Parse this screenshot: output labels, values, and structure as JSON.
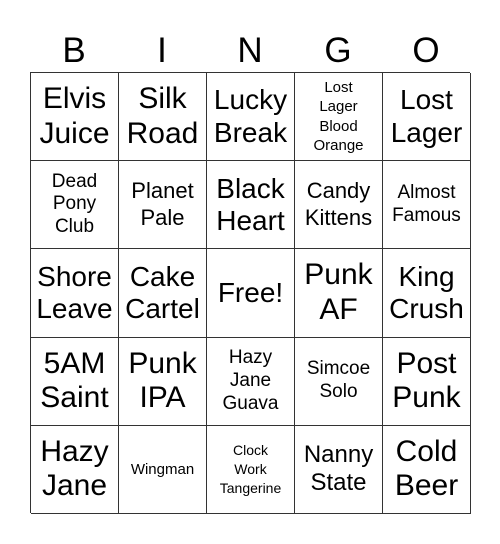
{
  "header": {
    "letters": [
      "B",
      "I",
      "N",
      "G",
      "O"
    ]
  },
  "grid": {
    "rows": [
      [
        "Elvis Juice",
        "Silk Road",
        "Lucky Break",
        "Lost Lager Blood Orange",
        "Lost Lager"
      ],
      [
        "Dead Pony Club",
        "Planet Pale",
        "Black Heart",
        "Candy Kittens",
        "Almost Famous"
      ],
      [
        "Shore Leave",
        "Cake Cartel",
        "Free!",
        "Punk AF",
        "King Crush"
      ],
      [
        "5AM Saint",
        "Punk IPA",
        "Hazy Jane Guava",
        "Simcoe Solo",
        "Post Punk"
      ],
      [
        "Hazy Jane",
        "Wingman",
        "Clock Work Tangerine",
        "Nanny State",
        "Cold Beer"
      ]
    ]
  }
}
